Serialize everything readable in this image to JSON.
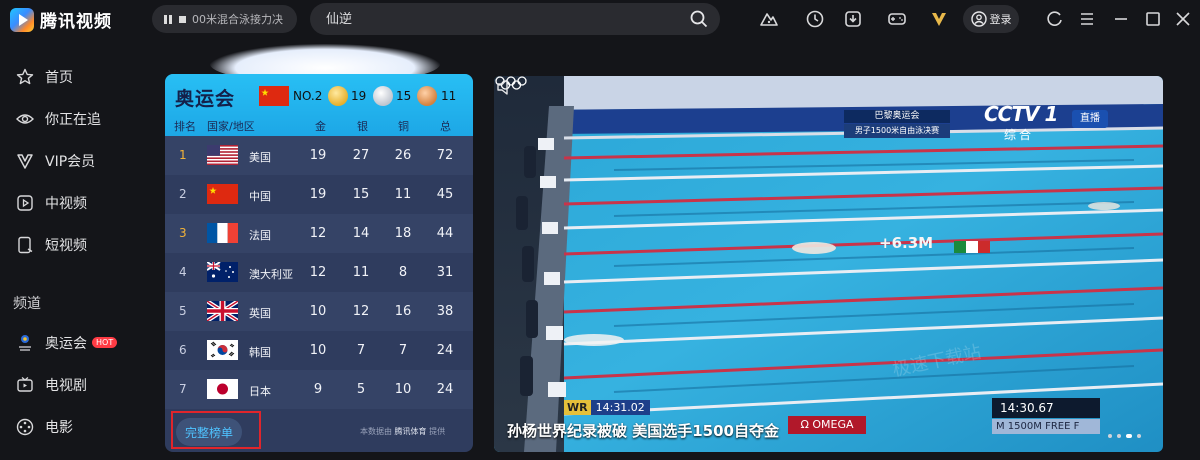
{
  "app": {
    "name": "腾讯视频"
  },
  "now_playing": {
    "text": "00米混合泳接力决"
  },
  "search": {
    "placeholder": "仙逆"
  },
  "header": {
    "login_label": "登录"
  },
  "sidebar": {
    "items": [
      {
        "label": "首页",
        "icon": "star-icon"
      },
      {
        "label": "你正在追",
        "icon": "eye-icon"
      },
      {
        "label": "VIP会员",
        "icon": "vip-icon"
      },
      {
        "label": "中视频",
        "icon": "play-box-icon"
      },
      {
        "label": "短视频",
        "icon": "phone-video-icon"
      }
    ],
    "section_title": "频道",
    "channels": [
      {
        "label": "奥运会",
        "icon": "olympics-icon",
        "badge": "HOT"
      },
      {
        "label": "电视剧",
        "icon": "tv-icon"
      },
      {
        "label": "电影",
        "icon": "film-reel-icon"
      }
    ]
  },
  "medals": {
    "title": "奥运会",
    "rank_label": "NO.2",
    "gold": "19",
    "silver": "15",
    "bronze": "11",
    "columns": [
      "排名",
      "国家/地区",
      "金",
      "银",
      "铜",
      "总"
    ],
    "rows": [
      {
        "rank": "1",
        "country": "美国",
        "gold": "19",
        "silver": "27",
        "bronze": "26",
        "total": "72"
      },
      {
        "rank": "2",
        "country": "中国",
        "gold": "19",
        "silver": "15",
        "bronze": "11",
        "total": "45"
      },
      {
        "rank": "3",
        "country": "法国",
        "gold": "12",
        "silver": "14",
        "bronze": "18",
        "total": "44"
      },
      {
        "rank": "4",
        "country": "澳大利亚",
        "gold": "12",
        "silver": "11",
        "bronze": "8",
        "total": "31"
      },
      {
        "rank": "5",
        "country": "英国",
        "gold": "10",
        "silver": "12",
        "bronze": "16",
        "total": "38"
      },
      {
        "rank": "6",
        "country": "韩国",
        "gold": "10",
        "silver": "7",
        "bronze": "7",
        "total": "24"
      },
      {
        "rank": "7",
        "country": "日本",
        "gold": "9",
        "silver": "5",
        "bronze": "10",
        "total": "24"
      }
    ],
    "full_list_label": "完整榜单",
    "source_prefix": "本数据由",
    "source_brand": "腾讯体育",
    "source_suffix": "提供"
  },
  "video": {
    "broadcast_title": "巴黎奥运会",
    "broadcast_event": "男子1500米自由泳决赛",
    "channel_logo": "CCTV 1",
    "channel_sub": "综合",
    "live_label": "直播",
    "gap_label": "+6.3M",
    "wr_label": "WR",
    "wr_time": "14:31.02",
    "caption": "孙杨世界纪录被破 美国选手1500自夺金",
    "sponsor": "Ω OMEGA",
    "race_time": "14:30.67",
    "event_label": "M 1500M FREE F",
    "watermark": "极速下载站"
  },
  "colors": {
    "accent": "#4fc3ff",
    "hot": "#ff3b44",
    "panel": "#2f3c5e",
    "header_blue": "#1da7e6",
    "gold_rank": "#f3b338"
  }
}
